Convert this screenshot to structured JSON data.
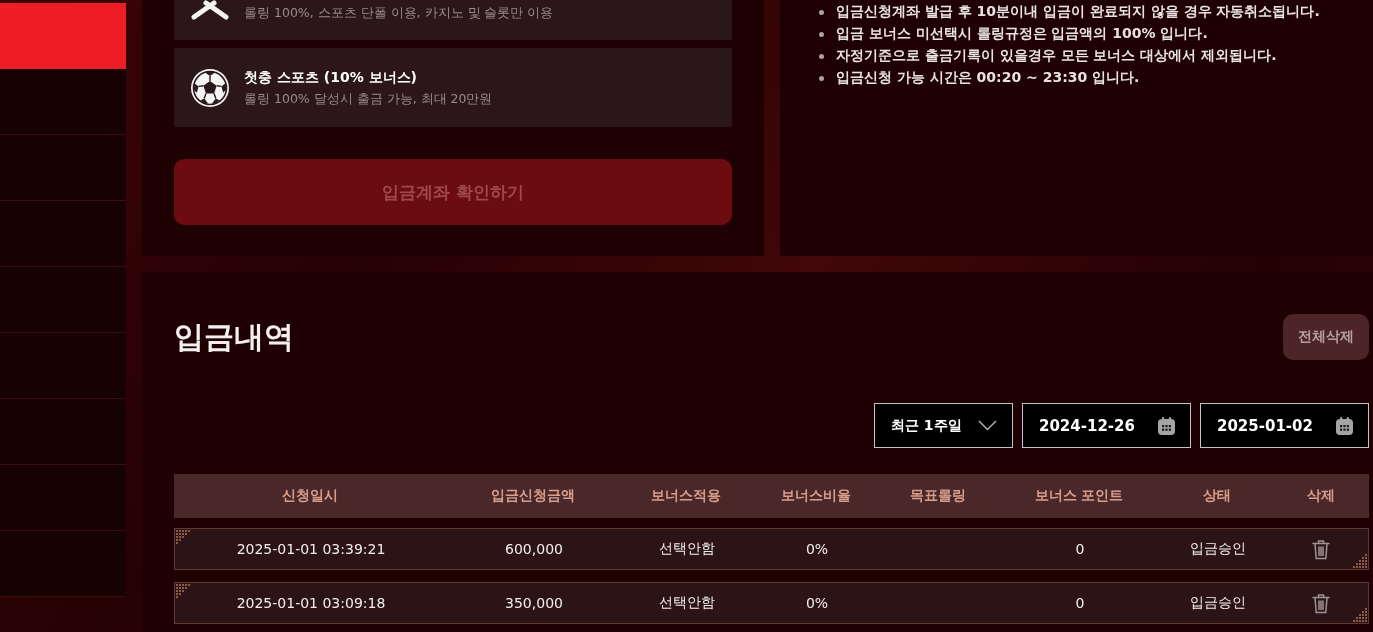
{
  "sidebar": {
    "items": [
      {
        "selected": true
      },
      {
        "selected": false
      },
      {
        "selected": false
      },
      {
        "selected": false
      },
      {
        "selected": false
      },
      {
        "selected": false
      },
      {
        "selected": false
      },
      {
        "selected": false
      },
      {
        "selected": false
      }
    ]
  },
  "bonus_options": [
    {
      "kind": "decline",
      "description": "롤링 100%, 스포츠 단폴 이용, 카지노 및 슬롯만 이용"
    },
    {
      "kind": "sports",
      "title": "첫충 스포츠 (10% 보너스)",
      "description": "롤링 100% 달성시 출금 가능, 최대 20만원"
    }
  ],
  "confirm_button": {
    "label": "입금계좌 확인하기",
    "disabled": true
  },
  "notices": [
    "입금신청계좌 발급 후 10분이내 입금이 완료되지 않을 경우 자동취소됩니다.",
    "입금 보너스 미선택시 롤링규정은 입금액의 100% 입니다.",
    "자정기준으로 출금기록이 있을경우 모든 보너스 대상에서 제외됩니다.",
    "입금신청 가능 시간은 00:20 ~ 23:30 입니다."
  ],
  "history": {
    "title": "입금내역",
    "delete_all_button": "전체삭제",
    "filters": {
      "period": "최근 1주일",
      "start_date": "2024-12-26",
      "end_date": "2025-01-02"
    },
    "table": {
      "columns": [
        "신청일시",
        "입금신청금액",
        "보너스적용",
        "보너스비율",
        "목표롤링",
        "보너스 포인트",
        "상태",
        "삭제"
      ],
      "rows": [
        {
          "date": "2025-01-01 03:39:21",
          "amount": "600,000",
          "bonus_applied": "선택안함",
          "bonus_rate": "0%",
          "bonus_points": "0",
          "status": "입금승인"
        },
        {
          "date": "2025-01-01 03:09:18",
          "amount": "350,000",
          "bonus_applied": "선택안함",
          "bonus_rate": "0%",
          "bonus_points": "0",
          "status": "입금승인"
        }
      ]
    }
  }
}
